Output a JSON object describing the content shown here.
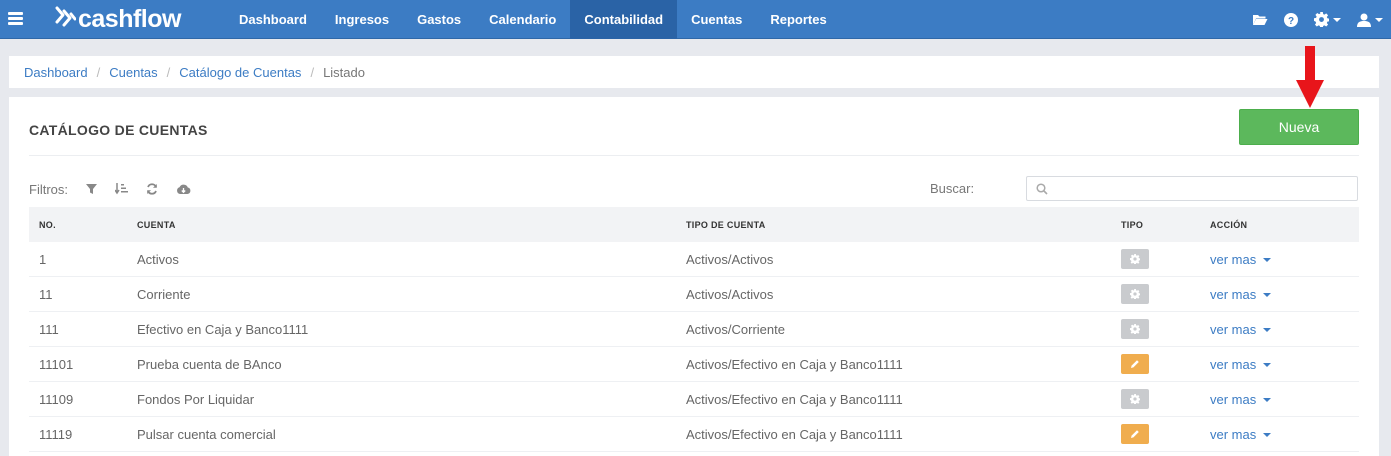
{
  "brand": {
    "name": "cashflow"
  },
  "nav": {
    "items": [
      {
        "label": "Dashboard",
        "active": false
      },
      {
        "label": "Ingresos",
        "active": false
      },
      {
        "label": "Gastos",
        "active": false
      },
      {
        "label": "Calendario",
        "active": false
      },
      {
        "label": "Contabilidad",
        "active": true
      },
      {
        "label": "Cuentas",
        "active": false
      },
      {
        "label": "Reportes",
        "active": false
      }
    ],
    "right_icons": [
      "folder-open-icon",
      "help-icon",
      "gear-icon",
      "user-icon"
    ]
  },
  "breadcrumb": {
    "items": [
      "Dashboard",
      "Cuentas",
      "Catálogo de Cuentas"
    ],
    "current": "Listado"
  },
  "panel": {
    "title": "CATÁLOGO DE CUENTAS",
    "new_button": "Nueva"
  },
  "filters": {
    "label": "Filtros:",
    "icons": [
      "filter-icon",
      "sort-icon",
      "refresh-icon",
      "cloud-download-icon"
    ],
    "search_label": "Buscar:",
    "search_value": ""
  },
  "table": {
    "headers": {
      "no": "NO.",
      "cuenta": "CUENTA",
      "tipo_cuenta": "TIPO DE CUENTA",
      "tipo": "TIPO",
      "accion": "ACCIÓN"
    },
    "rows": [
      {
        "no": "1",
        "cuenta": "Activos",
        "tipo_cuenta": "Activos/Activos",
        "tipo": "gear",
        "accion": "ver mas"
      },
      {
        "no": "11",
        "cuenta": "Corriente",
        "tipo_cuenta": "Activos/Activos",
        "tipo": "gear",
        "accion": "ver mas"
      },
      {
        "no": "111",
        "cuenta": "Efectivo en Caja y Banco1111",
        "tipo_cuenta": "Activos/Corriente",
        "tipo": "gear",
        "accion": "ver mas"
      },
      {
        "no": "11101",
        "cuenta": "Prueba cuenta de BAnco",
        "tipo_cuenta": "Activos/Efectivo en Caja y Banco1111",
        "tipo": "pencil",
        "accion": "ver mas"
      },
      {
        "no": "11109",
        "cuenta": "Fondos Por Liquidar",
        "tipo_cuenta": "Activos/Efectivo en Caja y Banco1111",
        "tipo": "gear",
        "accion": "ver mas"
      },
      {
        "no": "11119",
        "cuenta": "Pulsar cuenta comercial",
        "tipo_cuenta": "Activos/Efectivo en Caja y Banco1111",
        "tipo": "pencil",
        "accion": "ver mas"
      }
    ]
  },
  "colors": {
    "navbar": "#3c7cc4",
    "nav_active": "#2a63a6",
    "new_button": "#5cb85c",
    "link": "#3c7cc4",
    "tipo_gray": "#c9cbce",
    "tipo_orange": "#f0ad4e",
    "annotation_arrow": "#e8151b"
  }
}
